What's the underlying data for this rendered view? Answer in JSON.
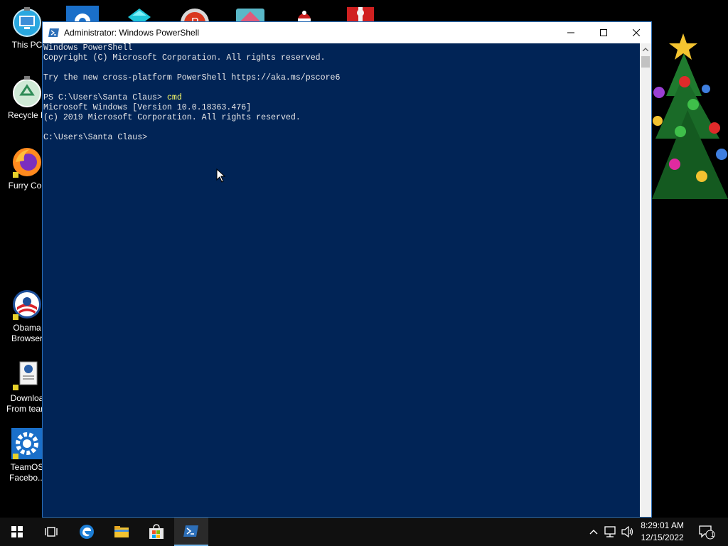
{
  "desktop": {
    "icons": [
      {
        "label": "This PC"
      },
      {
        "label": "Recycle B"
      },
      {
        "label": "Furry Coc"
      },
      {
        "label": "Obama\nBrowser"
      },
      {
        "label": "Downloa\nFrom team"
      },
      {
        "label": "TeamOS\nFacebo..."
      }
    ]
  },
  "window": {
    "title": "Administrator: Windows PowerShell",
    "console_lines": [
      "Windows PowerShell",
      "Copyright (C) Microsoft Corporation. All rights reserved.",
      "",
      "Try the new cross-platform PowerShell https://aka.ms/pscore6",
      ""
    ],
    "prompt": "PS C:\\Users\\Santa Claus> ",
    "typed_command": "cmd",
    "output_lines": [
      "Microsoft Windows [Version 10.0.18363.476]",
      "(c) 2019 Microsoft Corporation. All rights reserved.",
      "",
      "C:\\Users\\Santa Claus>"
    ]
  },
  "taskbar": {
    "time": "8:29:01 AM",
    "date": "12/15/2022",
    "notification_count": "1"
  },
  "colors": {
    "console_bg": "#012456",
    "accent": "#76b9ed"
  }
}
